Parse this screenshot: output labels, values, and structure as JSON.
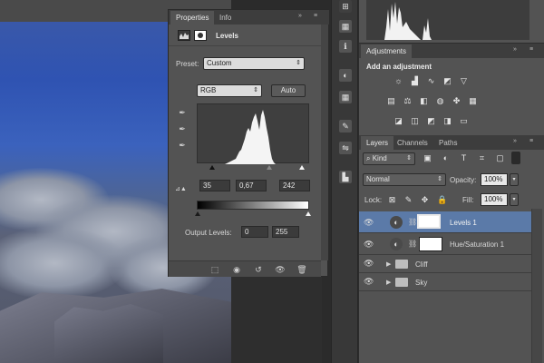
{
  "properties": {
    "tabs": [
      "Properties",
      "Info"
    ],
    "active_tab": "Properties",
    "header_title": "Levels",
    "preset_label": "Preset:",
    "preset_value": "Custom",
    "channel_value": "RGB",
    "auto_label": "Auto",
    "input_levels": {
      "black": "35",
      "gamma": "0,67",
      "white": "242"
    },
    "output_label": "Output Levels:",
    "output_levels": {
      "black": "0",
      "white": "255"
    }
  },
  "adjustments": {
    "tab_label": "Adjustments",
    "heading": "Add an adjustment"
  },
  "layers": {
    "tabs": [
      "Layers",
      "Channels",
      "Paths"
    ],
    "active_tab": "Layers",
    "filter_value": "Kind",
    "blend_mode": "Normal",
    "opacity_label": "Opacity:",
    "opacity_value": "100%",
    "lock_label": "Lock:",
    "fill_label": "Fill:",
    "fill_value": "100%",
    "items": [
      {
        "name": "Levels 1",
        "type": "adjustment",
        "selected": true
      },
      {
        "name": "Hue/Saturation 1",
        "type": "adjustment",
        "selected": false
      },
      {
        "name": "Cliff",
        "type": "group",
        "selected": false
      },
      {
        "name": "Sky",
        "type": "group",
        "selected": false
      }
    ]
  },
  "colors": {
    "panel_bg": "#535353",
    "selection": "#5b7aa8"
  }
}
